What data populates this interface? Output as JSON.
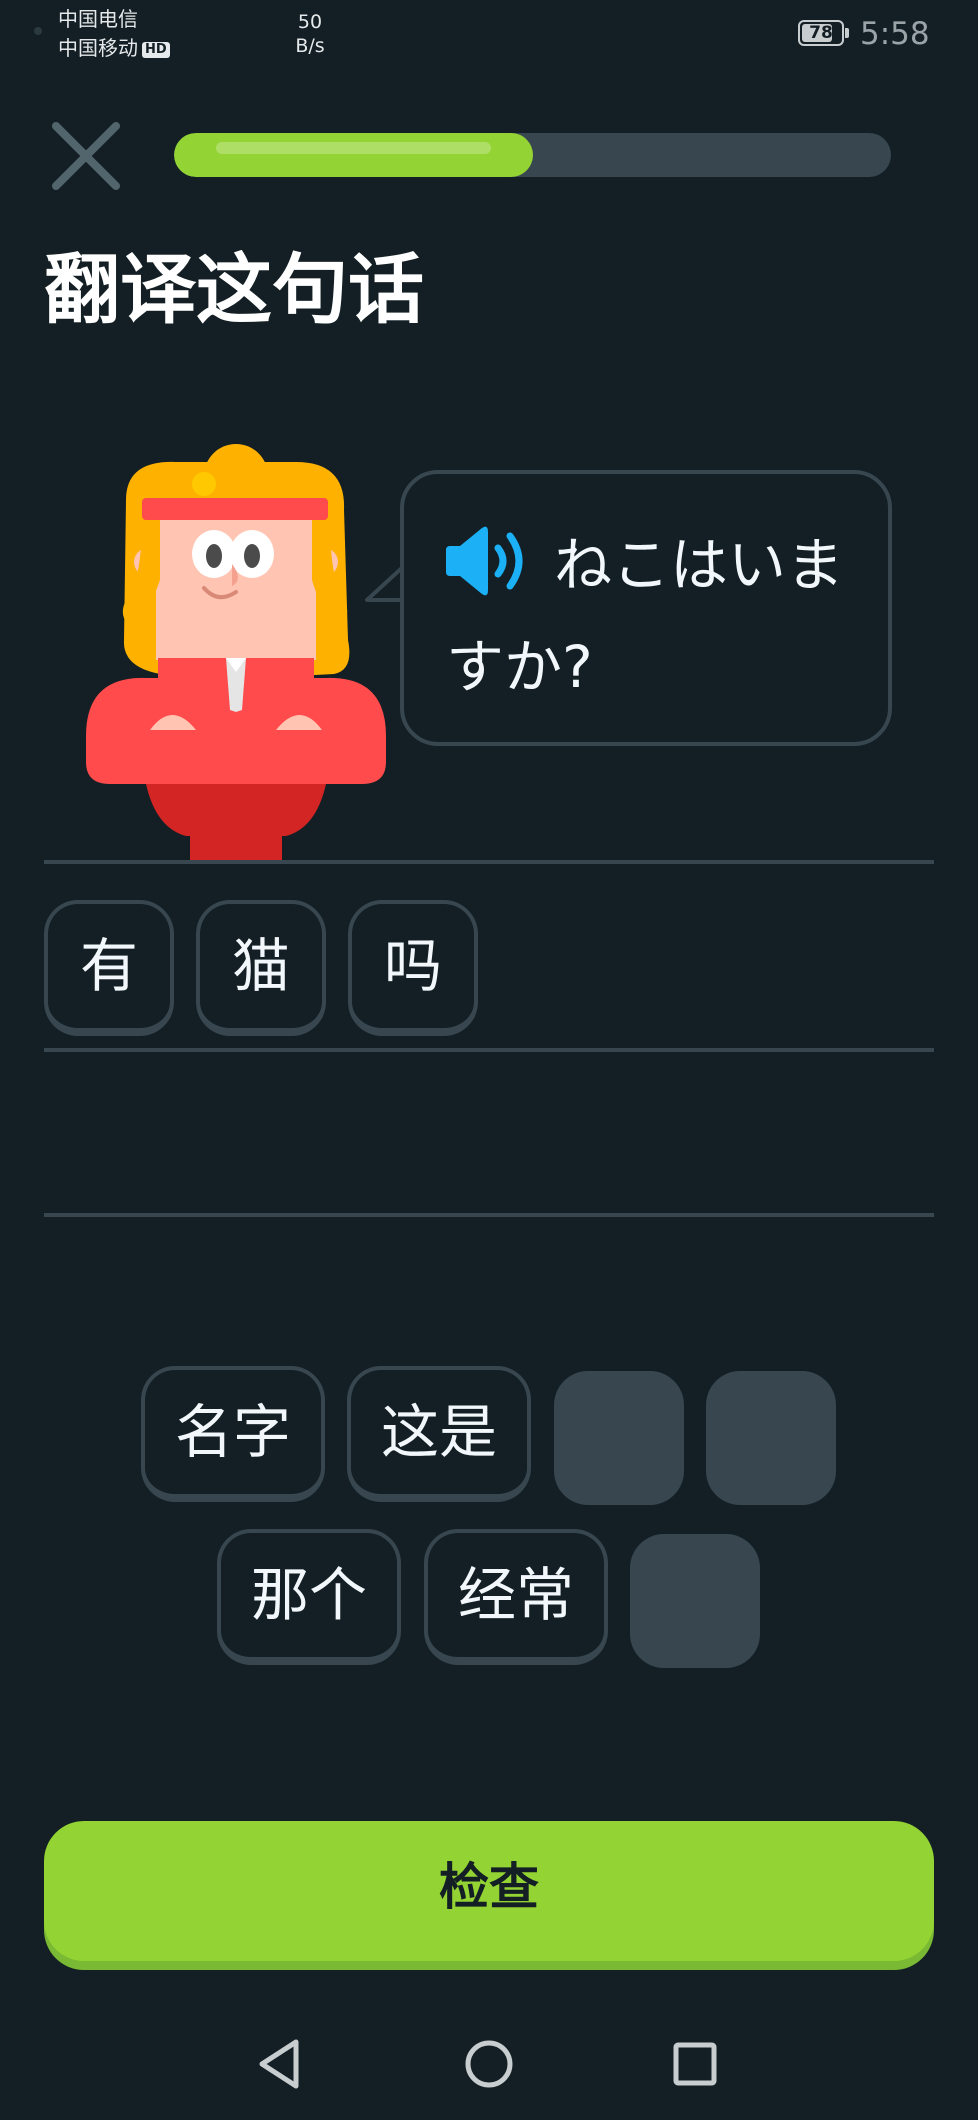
{
  "status_bar": {
    "carrier1": "中国电信",
    "carrier2": "中国移动",
    "hd_badge": "HD",
    "net_speed_value": "50",
    "net_speed_unit": "B/s",
    "battery": "78",
    "time": "5:58"
  },
  "lesson": {
    "progress_fraction": 0.5,
    "instruction": "翻译这句话",
    "prompt": "ねこはいますか?"
  },
  "answer_tiles": [
    "有",
    "猫",
    "吗"
  ],
  "word_bank": {
    "row1": [
      "名字",
      "这是"
    ],
    "row2": [
      "那个",
      "经常"
    ]
  },
  "check_button": "检查",
  "icons": {
    "close": "close-icon",
    "speaker": "speaker-icon",
    "back": "back-triangle-icon",
    "home": "home-circle-icon",
    "recents": "recents-square-icon"
  },
  "colors": {
    "background": "#131f24",
    "accent_green": "#93d333",
    "tile_border": "#37464f",
    "speaker_blue": "#1cb0f6"
  }
}
